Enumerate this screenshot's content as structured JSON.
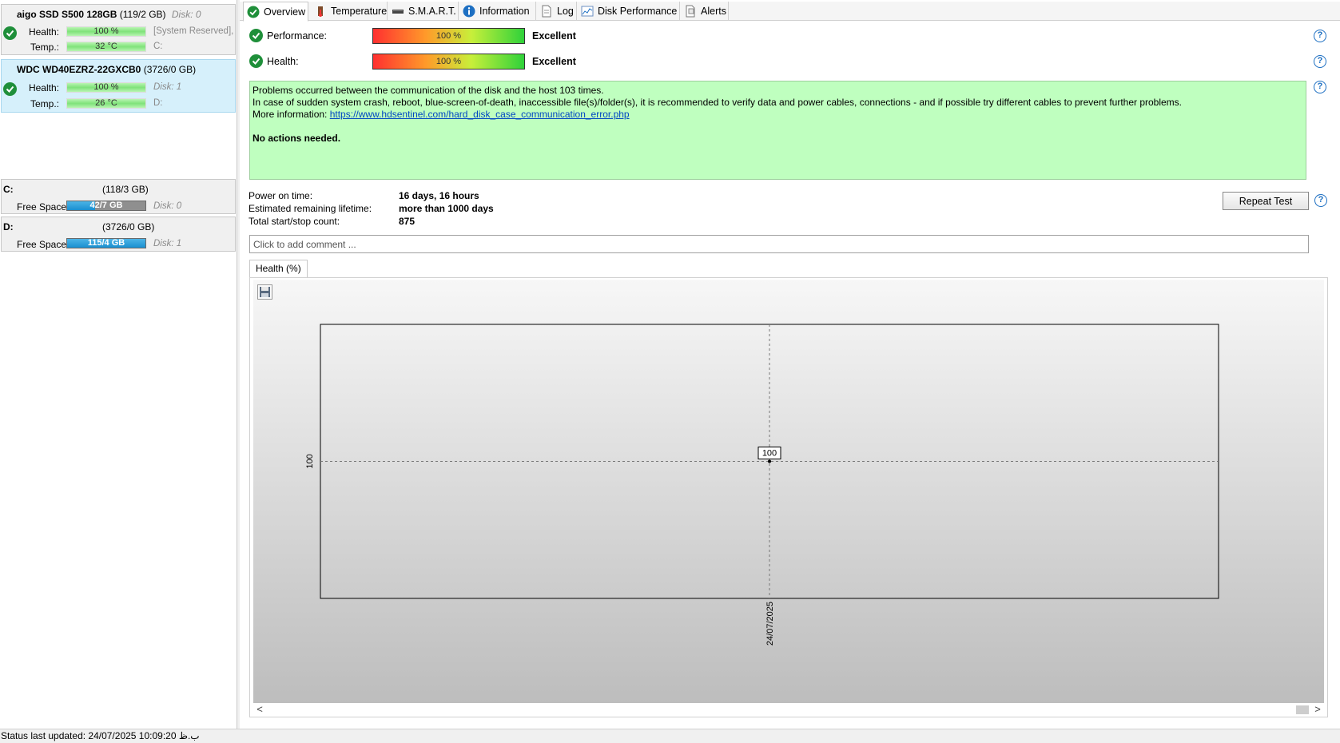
{
  "disks": [
    {
      "name": "aigo SSD S500 128GB",
      "size": "(119/2 GB)",
      "disk": "Disk: 0",
      "health_label": "Health:",
      "health_value": "100 %",
      "health_level": 100,
      "temp_label": "Temp.:",
      "temp_value": "32 °C",
      "side_info_1": "[System Reserved],",
      "side_info_2": "C:",
      "status_icon": "check-icon"
    },
    {
      "name": "WDC WD40EZRZ-22GXCB0",
      "size": "(3726/0 GB)",
      "health_label": "Health:",
      "health_value": "100 %",
      "health_level": 100,
      "temp_label": "Temp.:",
      "temp_value": "26 °C",
      "side_info_1": "Disk: 1",
      "side_info_2": "D:",
      "selected": true,
      "status_icon": "check-icon"
    }
  ],
  "volumes": [
    {
      "letter": "C:",
      "size": "(118/3 GB)",
      "label": "Free Space",
      "free": "42/7 GB",
      "free_fraction": 0.36,
      "disk": "Disk: 0"
    },
    {
      "letter": "D:",
      "size": "(3726/0 GB)",
      "label": "Free Space",
      "free": "115/4 GB",
      "free_fraction": 0.999,
      "disk": "Disk: 1"
    }
  ],
  "tabs": [
    {
      "label": "Overview",
      "icon": "check-circle-icon",
      "active": true
    },
    {
      "label": "Temperature",
      "icon": "thermometer-icon"
    },
    {
      "label": "S.M.A.R.T.",
      "icon": "drive-icon"
    },
    {
      "label": "Information",
      "icon": "info-icon"
    },
    {
      "label": "Log",
      "icon": "document-icon"
    },
    {
      "label": "Disk Performance",
      "icon": "performance-chart-icon"
    },
    {
      "label": "Alerts",
      "icon": "alerts-icon"
    }
  ],
  "overview": {
    "performance": {
      "label": "Performance:",
      "value": "100 %",
      "level": 100,
      "verdict": "Excellent"
    },
    "health": {
      "label": "Health:",
      "value": "100 %",
      "level": 100,
      "verdict": "Excellent"
    },
    "info_lines": [
      "Problems occurred between the communication of the disk and the host 103 times.",
      "In case of sudden system crash, reboot, blue-screen-of-death, inaccessible file(s)/folder(s), it is recommended to verify data and power cables, connections - and if possible try different cables to prevent further problems."
    ],
    "more_info_label": "More information:",
    "more_info_link": "https://www.hdsentinel.com/hard_disk_case_communication_error.php",
    "actions": "No actions needed.",
    "power_on_label": "Power on time:",
    "power_on_value": "16 days, 16 hours",
    "lifetime_label": "Estimated remaining lifetime:",
    "lifetime_value": "more than 1000 days",
    "startstop_label": "Total start/stop count:",
    "startstop_value": "875",
    "repeat_test_label": "Repeat Test",
    "comment_placeholder": "Click to add comment ...",
    "help_icon": "?"
  },
  "chart_tab_label": "Health (%)",
  "chart_data": {
    "type": "line",
    "x": [
      "24/07/2025"
    ],
    "y": [
      100
    ],
    "y_tick_labels": [
      "100"
    ],
    "point_labels": [
      "100"
    ],
    "grid": false,
    "background": "gradient-gray"
  },
  "scrollbar": {
    "left_arrow": "<",
    "right_arrow": ">"
  },
  "status_bar": "Status last updated: 24/07/2025 10:09:20 ب.ظ",
  "colors": {
    "ok_green": "#1f8f3a",
    "info_box": "#bfffbf",
    "link": "#0047c2",
    "help_blue": "#1d6fc2"
  }
}
